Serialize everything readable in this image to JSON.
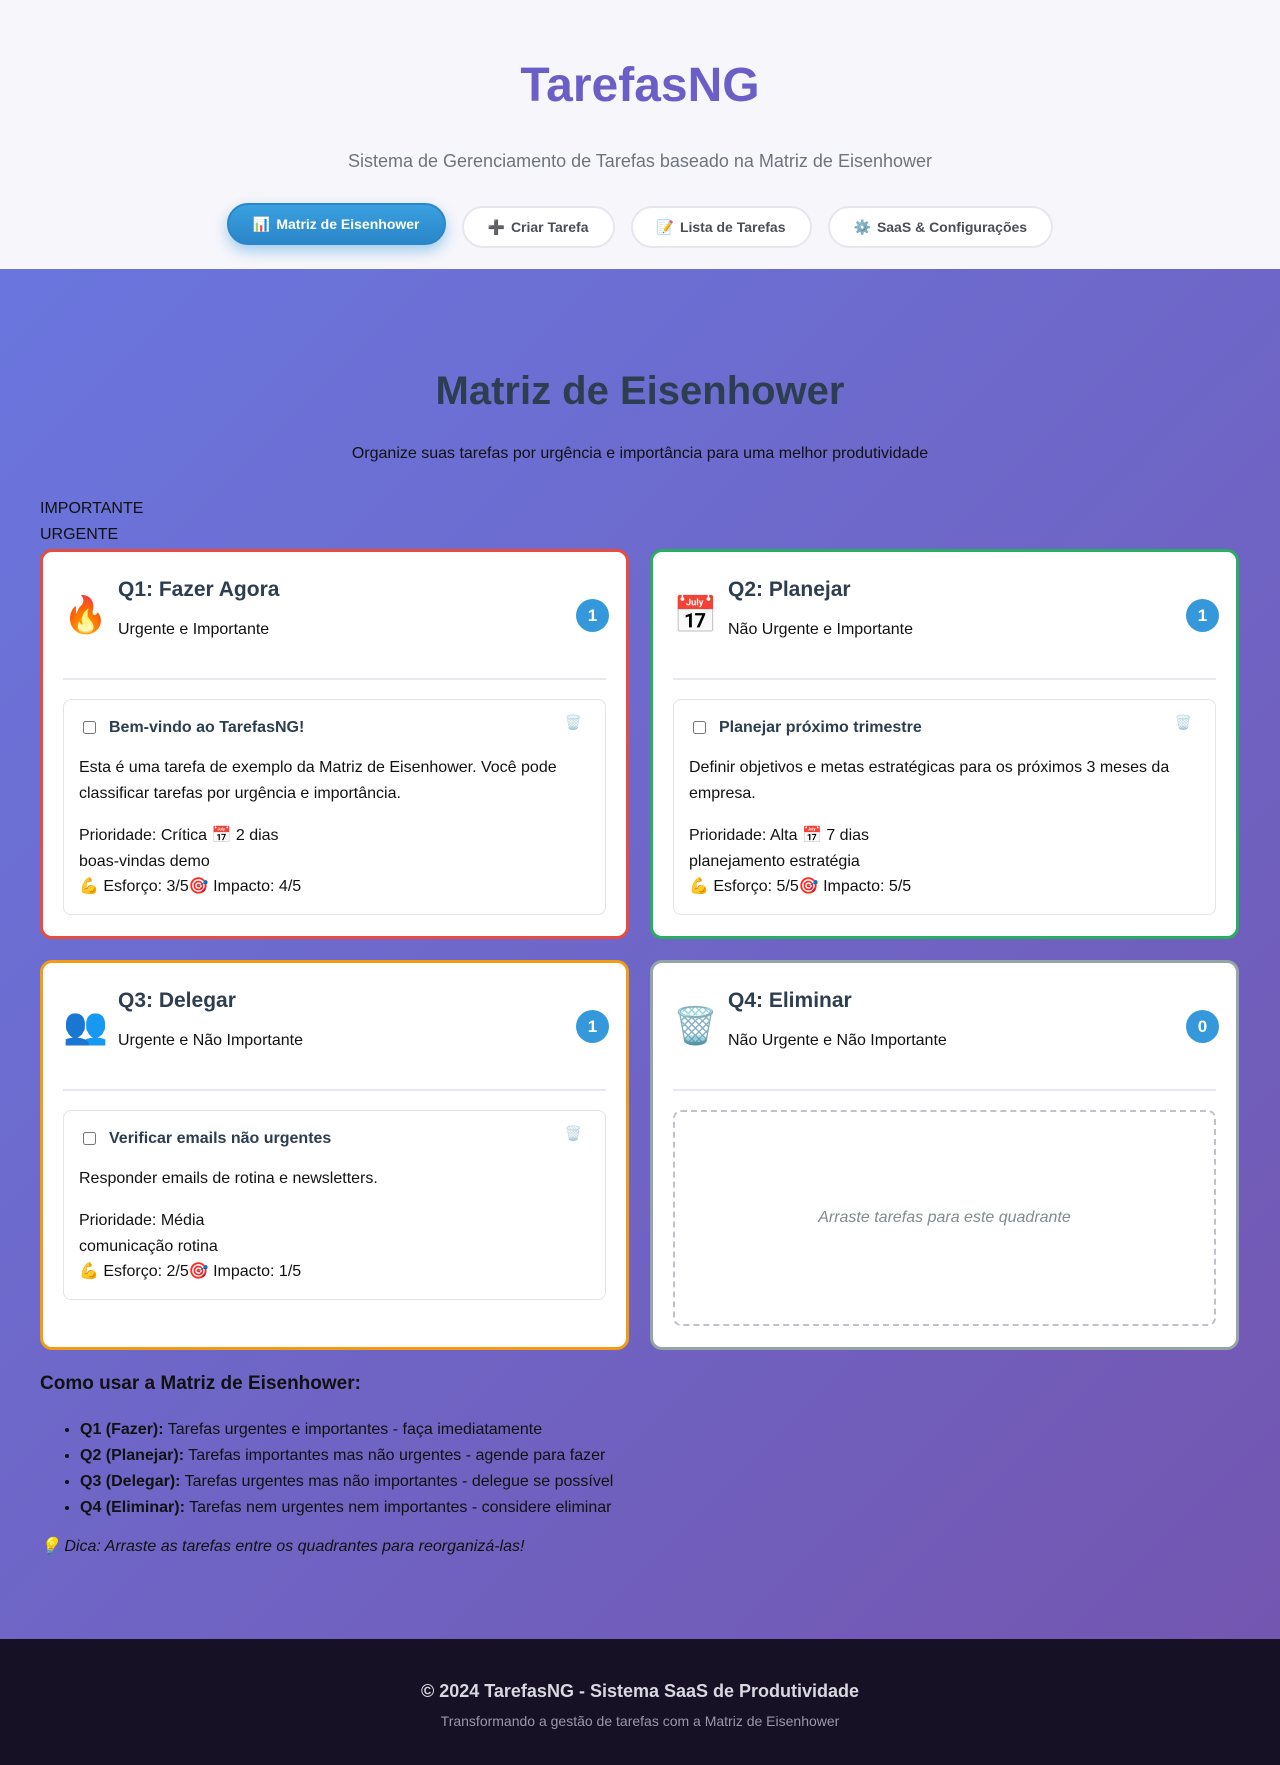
{
  "header": {
    "title": "TarefasNG",
    "subtitle": "Sistema de Gerenciamento de Tarefas baseado na Matriz de Eisenhower",
    "nav": [
      {
        "icon": "📊",
        "label": "Matriz de Eisenhower",
        "active": true
      },
      {
        "icon": "➕",
        "label": "Criar Tarefa",
        "active": false
      },
      {
        "icon": "📝",
        "label": "Lista de Tarefas",
        "active": false
      },
      {
        "icon": "⚙️",
        "label": "SaaS & Configurações",
        "active": false
      }
    ]
  },
  "main": {
    "title": "Matriz de Eisenhower",
    "description": "Organize suas tarefas por urgência e importância para uma melhor produtividade",
    "axis_important": "IMPORTANTE",
    "axis_urgent": "URGENTE",
    "quadrants": [
      {
        "icon": "🔥",
        "title": "Q1: Fazer Agora",
        "subtitle": "Urgente e Importante",
        "count": "1",
        "task": {
          "title": "Bem-vindo ao TarefasNG!",
          "delete_icon": "🗑️",
          "description": "Esta é uma tarefa de exemplo da Matriz de Eisenhower. Você pode classificar tarefas por urgência e importância.",
          "priority": "Prioridade: Crítica 📅 2 dias",
          "tags": "boas-vindas demo",
          "effort_impact": "💪 Esforço: 3/5🎯 Impacto: 4/5"
        }
      },
      {
        "icon": "📅",
        "title": "Q2: Planejar",
        "subtitle": "Não Urgente e Importante",
        "count": "1",
        "task": {
          "title": "Planejar próximo trimestre",
          "delete_icon": "🗑️",
          "description": "Definir objetivos e metas estratégicas para os próximos 3 meses da empresa.",
          "priority": "Prioridade: Alta 📅 7 dias",
          "tags": "planejamento estratégia",
          "effort_impact": "💪 Esforço: 5/5🎯 Impacto: 5/5"
        }
      },
      {
        "icon": "👥",
        "title": "Q3: Delegar",
        "subtitle": "Urgente e Não Importante",
        "count": "1",
        "task": {
          "title": "Verificar emails não urgentes",
          "delete_icon": "🗑️",
          "description": "Responder emails de rotina e newsletters.",
          "priority": "Prioridade: Média",
          "tags": "comunicação rotina",
          "effort_impact": "💪 Esforço: 2/5🎯 Impacto: 1/5"
        }
      },
      {
        "icon": "🗑️",
        "title": "Q4: Eliminar",
        "subtitle": "Não Urgente e Não Importante",
        "count": "0",
        "drop_zone": "Arraste tarefas para este quadrante"
      }
    ],
    "help": {
      "title": "Como usar a Matriz de Eisenhower:",
      "items": [
        {
          "label": "Q1 (Fazer):",
          "text": " Tarefas urgentes e importantes - faça imediatamente"
        },
        {
          "label": "Q2 (Planejar):",
          "text": " Tarefas importantes mas não urgentes - agende para fazer"
        },
        {
          "label": "Q3 (Delegar):",
          "text": " Tarefas urgentes mas não importantes - delegue se possível"
        },
        {
          "label": "Q4 (Eliminar):",
          "text": " Tarefas nem urgentes nem importantes - considere eliminar"
        }
      ],
      "tip": "💡 Dica: Arraste as tarefas entre os quadrantes para reorganizá-las!"
    }
  },
  "footer": {
    "title": "© 2024 TarefasNG - Sistema SaaS de Produtividade",
    "subtitle": "Transformando a gestão de tarefas com a Matriz de Eisenhower"
  },
  "colors": {
    "brand": "#6b5fc7",
    "accent": "#3498db",
    "q1_border": "#e74c3c",
    "q2_border": "#27ae60",
    "q3_border": "#f39c12",
    "q4_border": "#95a5a6"
  }
}
